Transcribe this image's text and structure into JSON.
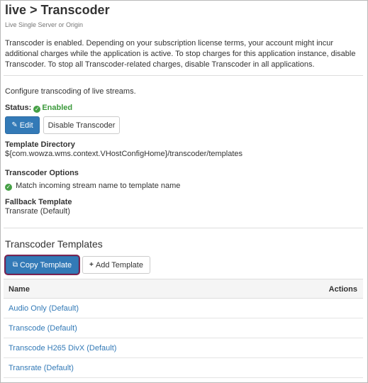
{
  "header": {
    "title": "live > Transcoder",
    "subtitle": "Live Single Server or Origin"
  },
  "notice": "Transcoder is enabled. Depending on your subscription license terms, your account might incur additional charges while the application is active. To stop charges for this application instance, disable Transcoder. To stop all Transcoder-related charges, disable Transcoder in all applications.",
  "intro": "Configure transcoding of live streams.",
  "status": {
    "label": "Status:",
    "value": "Enabled"
  },
  "buttons": {
    "edit": "Edit",
    "disable": "Disable Transcoder",
    "copy_template": "Copy Template",
    "add_template": "Add Template"
  },
  "template_directory": {
    "label": "Template Directory",
    "value": "${com.wowza.wms.context.VHostConfigHome}/transcoder/templates"
  },
  "transcoder_options": {
    "label": "Transcoder Options",
    "option": "Match incoming stream name to template name"
  },
  "fallback_template": {
    "label": "Fallback Template",
    "value": "Transrate (Default)"
  },
  "templates": {
    "title": "Transcoder Templates",
    "columns": [
      "Name",
      "Actions"
    ],
    "rows": [
      "Audio Only (Default)",
      "Transcode (Default)",
      "Transcode H265 DivX (Default)",
      "Transrate (Default)"
    ]
  },
  "colors": {
    "accent": "#337ab7",
    "status_green": "#3c9a3c",
    "focus_ring": "#7a2452"
  }
}
